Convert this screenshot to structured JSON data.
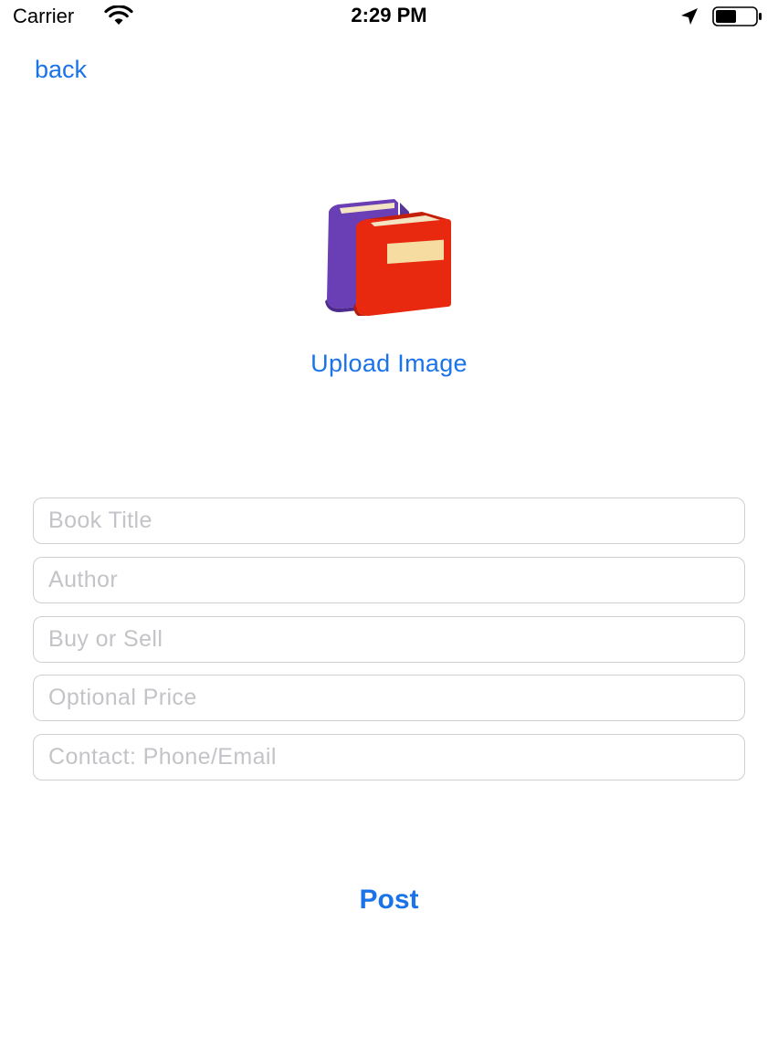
{
  "status_bar": {
    "carrier": "Carrier",
    "time": "2:29 PM",
    "icons": [
      "wifi-icon",
      "location-icon",
      "battery-icon"
    ]
  },
  "nav": {
    "back_label": "back"
  },
  "upload": {
    "icon": "books-icon",
    "label": "Upload Image"
  },
  "form": {
    "book_title": {
      "value": "",
      "placeholder": "Book Title"
    },
    "author": {
      "value": "",
      "placeholder": "Author"
    },
    "buy_or_sell": {
      "value": "",
      "placeholder": "Buy or Sell"
    },
    "price": {
      "value": "",
      "placeholder": "Optional Price"
    },
    "contact": {
      "value": "",
      "placeholder": "Contact: Phone/Email"
    }
  },
  "actions": {
    "post_label": "Post"
  },
  "colors": {
    "accent": "#1a73e8",
    "placeholder": "#c4c4c8",
    "border": "#cfcfcf"
  }
}
